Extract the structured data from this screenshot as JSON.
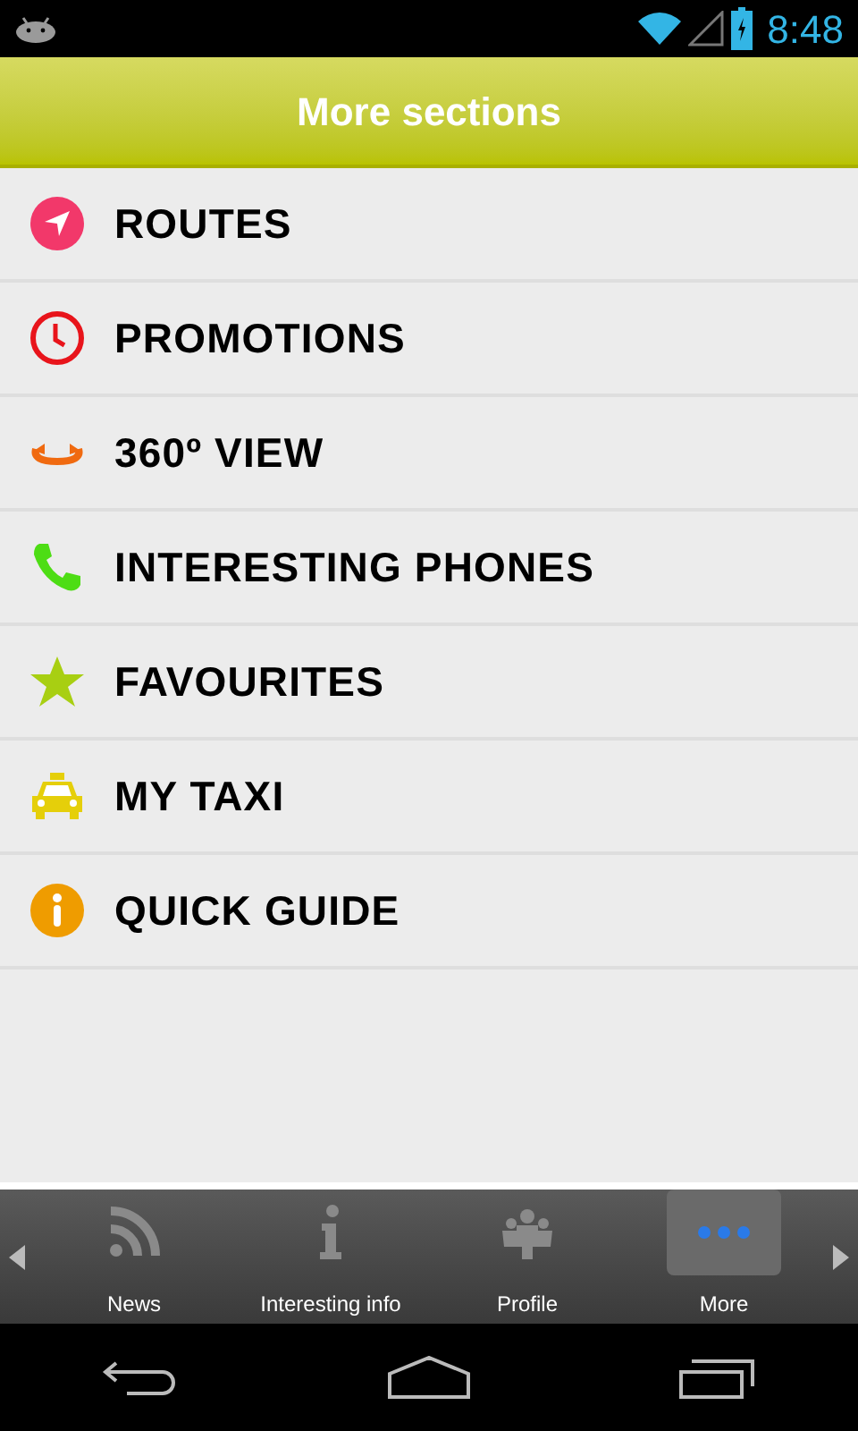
{
  "status_bar": {
    "time": "8:48"
  },
  "header": {
    "title": "More sections"
  },
  "sections": [
    {
      "kind": "routes",
      "label": "ROUTES"
    },
    {
      "kind": "promotions",
      "label": "PROMOTIONS"
    },
    {
      "kind": "view",
      "label": "360º VIEW"
    },
    {
      "kind": "phones",
      "label": "INTERESTING PHONES"
    },
    {
      "kind": "favourites",
      "label": "FAVOURITES"
    },
    {
      "kind": "taxi",
      "label": "MY TAXI"
    },
    {
      "kind": "guide",
      "label": "QUICK GUIDE"
    }
  ],
  "tabs": [
    {
      "kind": "news",
      "label": "News",
      "selected": false
    },
    {
      "kind": "info",
      "label": "Interesting info",
      "selected": false
    },
    {
      "kind": "profile",
      "label": "Profile",
      "selected": false
    },
    {
      "kind": "more",
      "label": "More",
      "selected": true
    }
  ]
}
